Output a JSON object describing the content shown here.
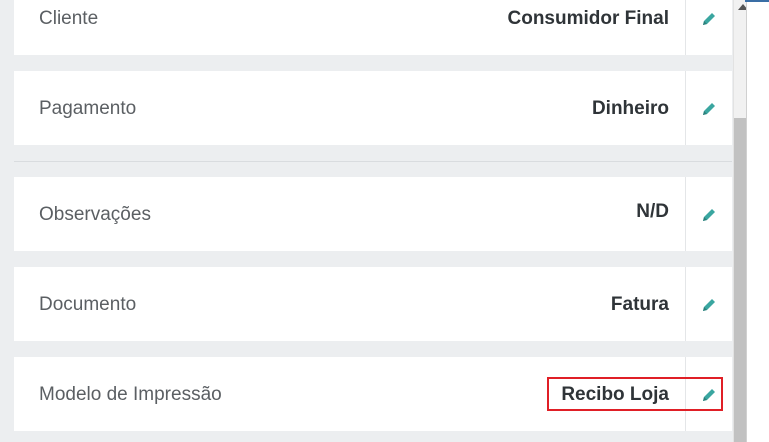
{
  "rows": [
    {
      "label": "Cliente",
      "value": "Consumidor Final"
    },
    {
      "label": "Pagamento",
      "value": "Dinheiro"
    },
    {
      "label": "Observações",
      "value": "N/D"
    },
    {
      "label": "Documento",
      "value": "Fatura"
    },
    {
      "label": "Modelo de Impressão",
      "value": "Recibo Loja"
    }
  ],
  "colors": {
    "edit_icon": "#3aa6a0",
    "highlight": "#e01f26"
  },
  "icons": {
    "edit": "pencil-icon"
  }
}
